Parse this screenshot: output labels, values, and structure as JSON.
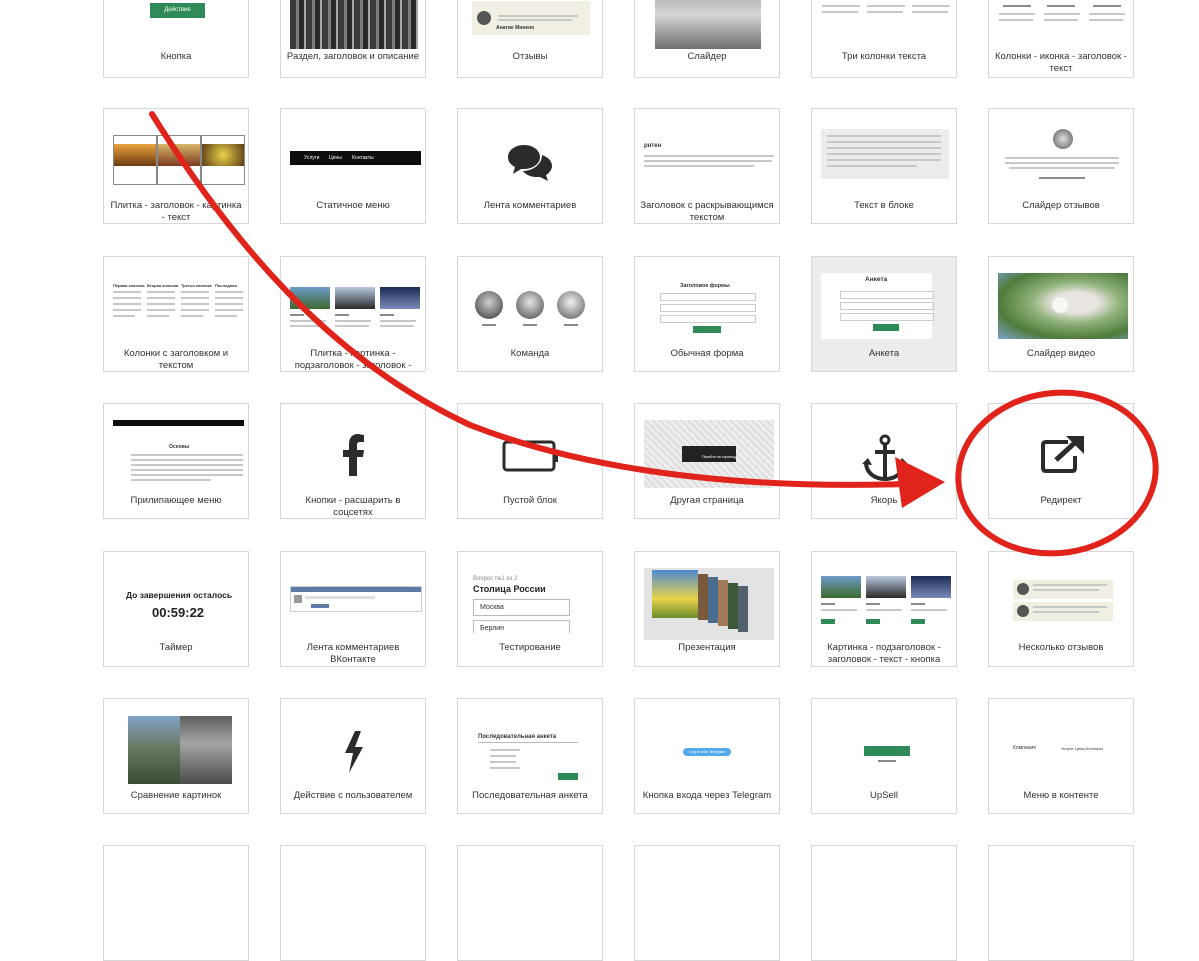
{
  "blocks": {
    "b0_0": {
      "label": "Кнопка",
      "button": "Действие"
    },
    "b0_1": {
      "label": "Раздел, заголовок и описание"
    },
    "b0_2": {
      "label": "Отзывы",
      "author": "Анатие Минено"
    },
    "b0_3": {
      "label": "Слайдер"
    },
    "b0_4": {
      "label": "Три колонки текста"
    },
    "b0_5": {
      "label": "Колонки - иконка - заголовок - текст"
    },
    "b1_0": {
      "label": "Плитка - заголовок - картинка - текст"
    },
    "b1_1": {
      "label": "Статичное меню",
      "menu": [
        "Услуги",
        "Цены",
        "Контакты"
      ]
    },
    "b1_2": {
      "label": "Лента комментариев"
    },
    "b1_3": {
      "label": "Заголовок с раскрывающимся текстом",
      "title": "рнтен"
    },
    "b1_4": {
      "label": "Текст в блоке"
    },
    "b1_5": {
      "label": "Слайдер отзывов"
    },
    "b2_0": {
      "label": "Колонки с заголовком и текстом",
      "cols": [
        "Первая колонка",
        "Вторая колонка",
        "Третья колонка",
        "Последняя"
      ]
    },
    "b2_1": {
      "label": "Плитка - картинка - подзаголовок - заголовок - текст"
    },
    "b2_2": {
      "label": "Команда"
    },
    "b2_3": {
      "label": "Обычная форма",
      "title": "Заголовок формы"
    },
    "b2_4": {
      "label": "Анкета",
      "title": "Анкета"
    },
    "b2_5": {
      "label": "Слайдер видео"
    },
    "b3_0": {
      "label": "Прилипающее меню",
      "title": "Основы"
    },
    "b3_1": {
      "label": "Кнопки - расшарить в соцсетях"
    },
    "b3_2": {
      "label": "Пустой блок"
    },
    "b3_3": {
      "label": "Другая страница",
      "btn": "Перейти на страницу"
    },
    "b3_4": {
      "label": "Якорь"
    },
    "b3_5": {
      "label": "Редирект"
    },
    "b4_0": {
      "label": "Таймер",
      "heading": "До завершения осталось",
      "time": "00:59:22"
    },
    "b4_1": {
      "label": "Лента комментариев ВКонтакте"
    },
    "b4_2": {
      "label": "Тестирование",
      "q": "Вопрос №1 из 2",
      "title": "Столица России",
      "opts": [
        "Москва",
        "Берлин"
      ]
    },
    "b4_3": {
      "label": "Презентация"
    },
    "b4_4": {
      "label": "Картинка - подзаголовок - заголовок - текст - кнопка"
    },
    "b4_5": {
      "label": "Несколько отзывов"
    },
    "b5_0": {
      "label": "Сравнение картинок"
    },
    "b5_1": {
      "label": "Действие с пользователем"
    },
    "b5_2": {
      "label": "Последовательная анкета",
      "title": "Последовательная анкета"
    },
    "b5_3": {
      "label": "Кнопка входа через Telegram",
      "btn": "Log in with Telegram"
    },
    "b5_4": {
      "label": "UpSell"
    },
    "b5_5": {
      "label": "Меню в контенте",
      "company": "Компания",
      "menu": [
        "Услуги",
        "Цены",
        "Контакты"
      ]
    }
  },
  "annotation_color": "#e0231b",
  "accent_green": "#2e8b57"
}
